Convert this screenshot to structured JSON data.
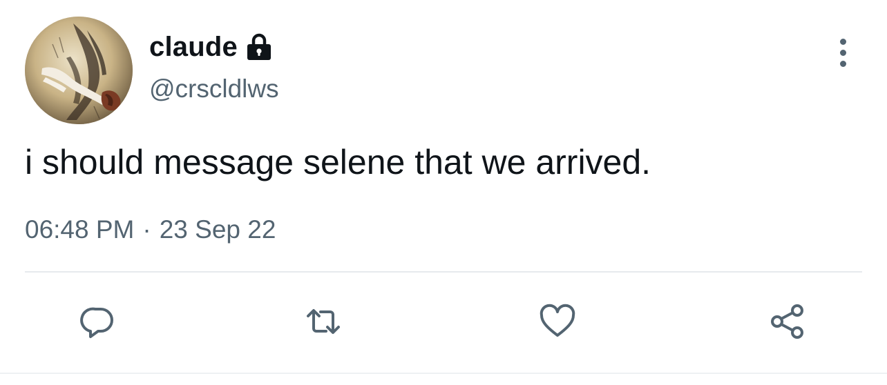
{
  "tweet": {
    "author": {
      "display_name": "claude",
      "handle": "@crscldlws",
      "protected": true
    },
    "text": "i should message selene that we arrived.",
    "time": "06:48 PM",
    "separator": "·",
    "date": "23 Sep 22"
  },
  "actions": {
    "reply_icon": "reply-icon",
    "retweet_icon": "retweet-icon",
    "like_icon": "heart-icon",
    "share_icon": "share-icon",
    "more_icon": "more-vertical-icon"
  },
  "colors": {
    "text_primary": "#0f1419",
    "text_secondary": "#536471",
    "divider": "#e6eaed"
  }
}
